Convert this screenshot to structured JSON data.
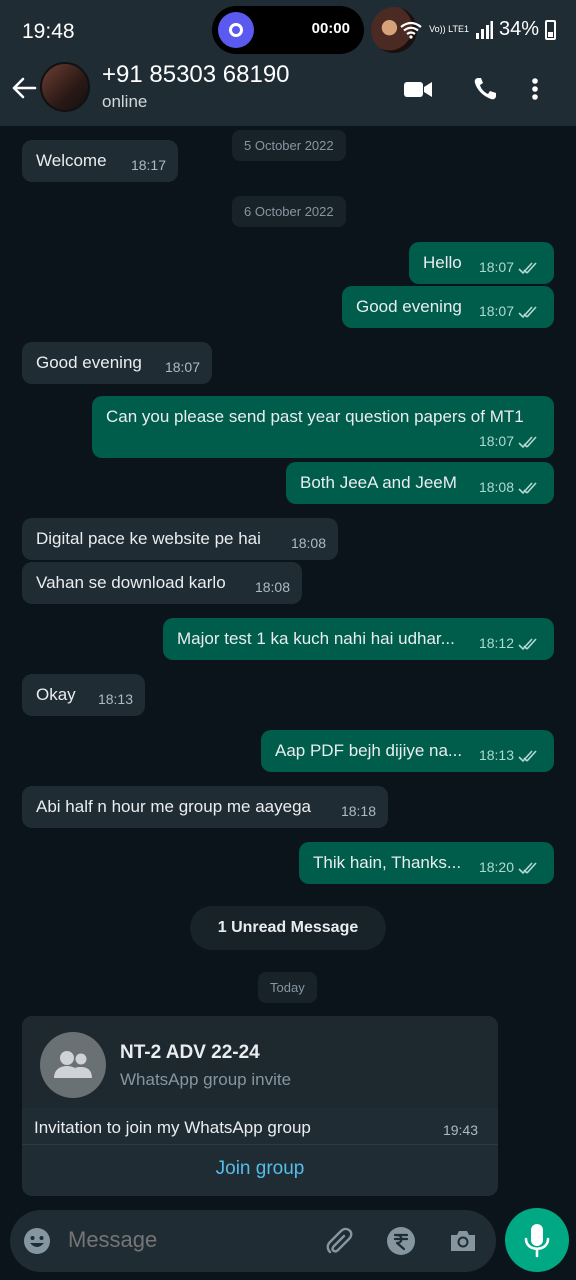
{
  "status_bar": {
    "time": "19:48",
    "timer": "00:00",
    "volte": "Vo)) LTE1",
    "battery": "34%"
  },
  "header": {
    "contact_name": "+91 85303 68190",
    "contact_status": "online",
    "icons": [
      "back-arrow-icon",
      "video-call-icon",
      "voice-call-icon",
      "more-options-icon"
    ]
  },
  "chat": {
    "dates": {
      "d1": "5 October 2022",
      "d2": "6 October 2022",
      "d3": "Today"
    },
    "messages": [
      {
        "dir": "in",
        "text": "Welcome",
        "time": "18:17"
      },
      {
        "dir": "out",
        "text": "Hello",
        "time": "18:07"
      },
      {
        "dir": "out",
        "text": "Good evening",
        "time": "18:07"
      },
      {
        "dir": "in",
        "text": "Good evening",
        "time": "18:07"
      },
      {
        "dir": "out",
        "text": "Can you please send past year question papers of MT1",
        "time": "18:07"
      },
      {
        "dir": "out",
        "text": "Both JeeA and JeeM",
        "time": "18:08"
      },
      {
        "dir": "in",
        "text": "Digital pace ke website pe hai",
        "time": "18:08"
      },
      {
        "dir": "in",
        "text": "Vahan se download karlo",
        "time": "18:08"
      },
      {
        "dir": "out",
        "text": "Major test 1 ka kuch nahi hai udhar...",
        "time": "18:12"
      },
      {
        "dir": "in",
        "text": "Okay",
        "time": "18:13"
      },
      {
        "dir": "out",
        "text": "Aap PDF bejh dijiye na...",
        "time": "18:13"
      },
      {
        "dir": "in",
        "text": "Abi half n hour me group me aayega",
        "time": "18:18"
      },
      {
        "dir": "out",
        "text": "Thik hain, Thanks...",
        "time": "18:20"
      }
    ],
    "unread_label": "1 Unread Message",
    "invite": {
      "group_name": "NT-2 ADV 22-24",
      "subtitle": "WhatsApp group invite",
      "text": "Invitation to join my WhatsApp group",
      "time": "19:43",
      "button": "Join group"
    }
  },
  "composer": {
    "placeholder": "Message",
    "icons": [
      "emoji-icon",
      "attach-icon",
      "rupee-payment-icon",
      "camera-icon",
      "mic-icon"
    ]
  },
  "colors": {
    "background": "#0b141a",
    "bar": "#1f2c34",
    "incoming": "#202c33",
    "outgoing": "#005c4b",
    "accent": "#00a884",
    "link": "#53bdeb"
  }
}
